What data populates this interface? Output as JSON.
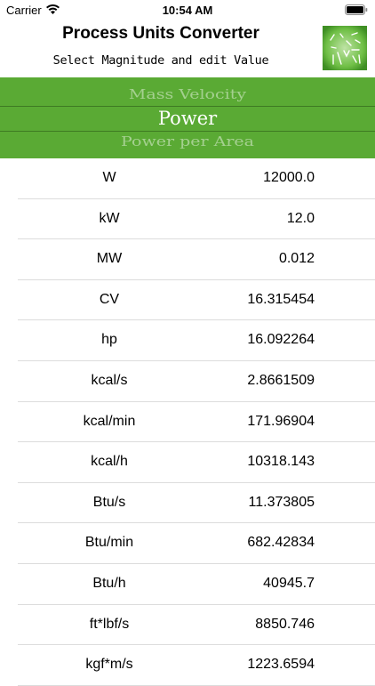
{
  "status_bar": {
    "carrier": "Carrier",
    "time": "10:54 AM"
  },
  "header": {
    "title": "Process Units Converter",
    "subtitle": "Select Magnitude and edit Value",
    "logo_icon": "units-app-logo-icon"
  },
  "picker": {
    "previous": "Mass Velocity",
    "selected": "Power",
    "next": "Power per Area",
    "color": "#5aaa34"
  },
  "units": [
    {
      "unit": "W",
      "value": "12000.0"
    },
    {
      "unit": "kW",
      "value": "12.0"
    },
    {
      "unit": "MW",
      "value": "0.012"
    },
    {
      "unit": "CV",
      "value": "16.315454"
    },
    {
      "unit": "hp",
      "value": "16.092264"
    },
    {
      "unit": "kcal/s",
      "value": "2.8661509"
    },
    {
      "unit": "kcal/min",
      "value": "171.96904"
    },
    {
      "unit": "kcal/h",
      "value": "10318.143"
    },
    {
      "unit": "Btu/s",
      "value": "11.373805"
    },
    {
      "unit": "Btu/min",
      "value": "682.42834"
    },
    {
      "unit": "Btu/h",
      "value": "40945.7"
    },
    {
      "unit": "ft*lbf/s",
      "value": "8850.746"
    },
    {
      "unit": "kgf*m/s",
      "value": "1223.6594"
    }
  ]
}
